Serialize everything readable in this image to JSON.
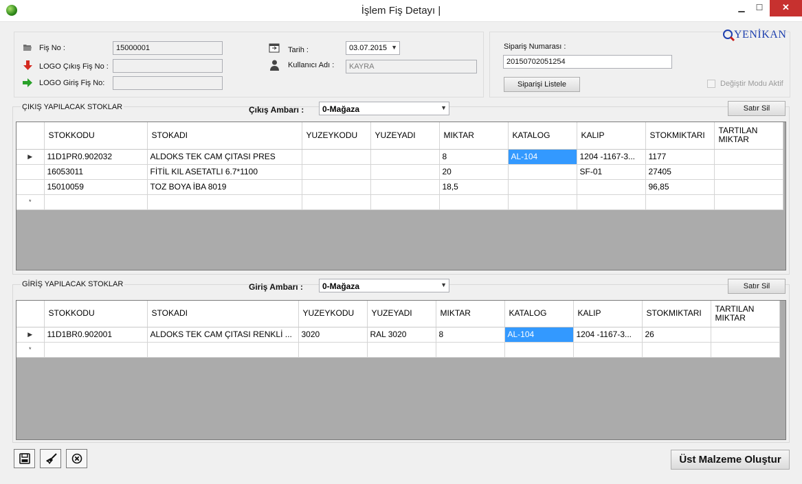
{
  "window": {
    "title": "İşlem Fiş Detayı |",
    "min": "▁",
    "max": "☐",
    "close": "✕"
  },
  "header": {
    "fis_no_label": "Fiş No :",
    "fis_no_value": "15000001",
    "logo_cikis_label": "LOGO Çıkış Fiş No :",
    "logo_cikis_value": "",
    "logo_giris_label": "LOGO Giriş Fiş No:",
    "logo_giris_value": "",
    "tarih_label": "Tarih :",
    "tarih_value": "03.07.2015",
    "kullanici_label": "Kullanıcı Adı :",
    "kullanici_value": "KAYRA",
    "siparis_label": "Sipariş Numarası :",
    "siparis_value": "20150702051254",
    "siparis_listele": "Siparişi Listele",
    "degistir_label": "Değiştir Modu Aktif",
    "logo_text": "YENİKAN"
  },
  "cikis": {
    "section_title": "ÇIKIŞ YAPILACAK STOKLAR",
    "ambar_label": "Çıkış Ambarı :",
    "ambar_value": "0-Mağaza",
    "satir_sil": "Satır Sil",
    "columns": [
      "STOKKODU",
      "STOKADI",
      "YUZEYKODU",
      "YUZEYADI",
      "MIKTAR",
      "KATALOG",
      "KALIP",
      "STOKMIKTARI",
      "TARTILAN MIKTAR"
    ],
    "rows": [
      {
        "marker": "▶",
        "cells": [
          "11D1PR0.902032",
          "ALDOKS TEK CAM ÇITASI PRES",
          "",
          "",
          "8",
          "AL-104",
          "1204 -1167-3...",
          "1177",
          ""
        ]
      },
      {
        "marker": "",
        "cells": [
          "16053011",
          "FİTİL KIL ASETATLI 6.7*1100",
          "",
          "",
          "20",
          "",
          "SF-01",
          "27405",
          ""
        ]
      },
      {
        "marker": "",
        "cells": [
          "15010059",
          "TOZ BOYA İBA 8019",
          "",
          "",
          "18,5",
          "",
          "",
          "96,85",
          ""
        ]
      },
      {
        "marker": "*",
        "cells": [
          "",
          "",
          "",
          "",
          "",
          "",
          "",
          "",
          ""
        ]
      }
    ]
  },
  "giris": {
    "section_title": "GİRİŞ YAPILACAK STOKLAR",
    "ambar_label": "Giriş Ambarı :",
    "ambar_value": "0-Mağaza",
    "satir_sil": "Satır Sil",
    "columns": [
      "STOKKODU",
      "STOKADI",
      "YUZEYKODU",
      "YUZEYADI",
      "MIKTAR",
      "KATALOG",
      "KALIP",
      "STOKMIKTARI",
      "TARTILAN MIKTAR"
    ],
    "rows": [
      {
        "marker": "▶",
        "cells": [
          "11D1BR0.902001",
          "ALDOKS TEK CAM ÇITASI RENKLİ ...",
          "3020",
          "RAL 3020",
          "8",
          "AL-104",
          "1204 -1167-3...",
          "26",
          ""
        ]
      },
      {
        "marker": "*",
        "cells": [
          "",
          "",
          "",
          "",
          "",
          "",
          "",
          "",
          ""
        ]
      }
    ]
  },
  "footer": {
    "ust_malzeme": "Üst Malzeme Oluştur"
  },
  "colors": {
    "selection": "#3399ff",
    "grid_background": "#ababab",
    "close_button": "#c7312f"
  }
}
